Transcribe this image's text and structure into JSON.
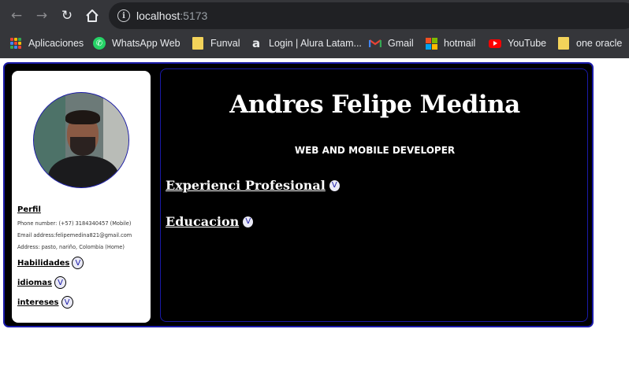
{
  "browser": {
    "url_host": "localhost",
    "url_port": ":5173",
    "bookmarks": [
      {
        "label": "Aplicaciones",
        "icon": "apps-grid-icon"
      },
      {
        "label": "WhatsApp Web",
        "icon": "whatsapp-icon"
      },
      {
        "label": "Funval",
        "icon": "folder-icon"
      },
      {
        "label": "Login | Alura Latam...",
        "icon": "alura-icon"
      },
      {
        "label": "Gmail",
        "icon": "gmail-icon"
      },
      {
        "label": "hotmail",
        "icon": "microsoft-icon"
      },
      {
        "label": "YouTube",
        "icon": "youtube-icon"
      },
      {
        "label": "one oracle",
        "icon": "folder-icon"
      }
    ]
  },
  "sidebar": {
    "profile_title": "Perfil",
    "phone": "Phone number: (+57) 3184340457 (Mobile)",
    "email": "Email address:felipemedina821@gmail.com",
    "address": "Address: pasto, nariño, Colombia (Home)",
    "sections": [
      {
        "label": "Habilidades",
        "toggle": "V"
      },
      {
        "label": "idiomas",
        "toggle": "V"
      },
      {
        "label": "intereses",
        "toggle": "V"
      }
    ]
  },
  "main": {
    "name": "Andres Felipe Medina",
    "role": "WEB AND MOBILE DEVELOPER",
    "sections": [
      {
        "label": "Experienci Profesional",
        "toggle": "V"
      },
      {
        "label": "Educacion",
        "toggle": "V"
      }
    ]
  }
}
